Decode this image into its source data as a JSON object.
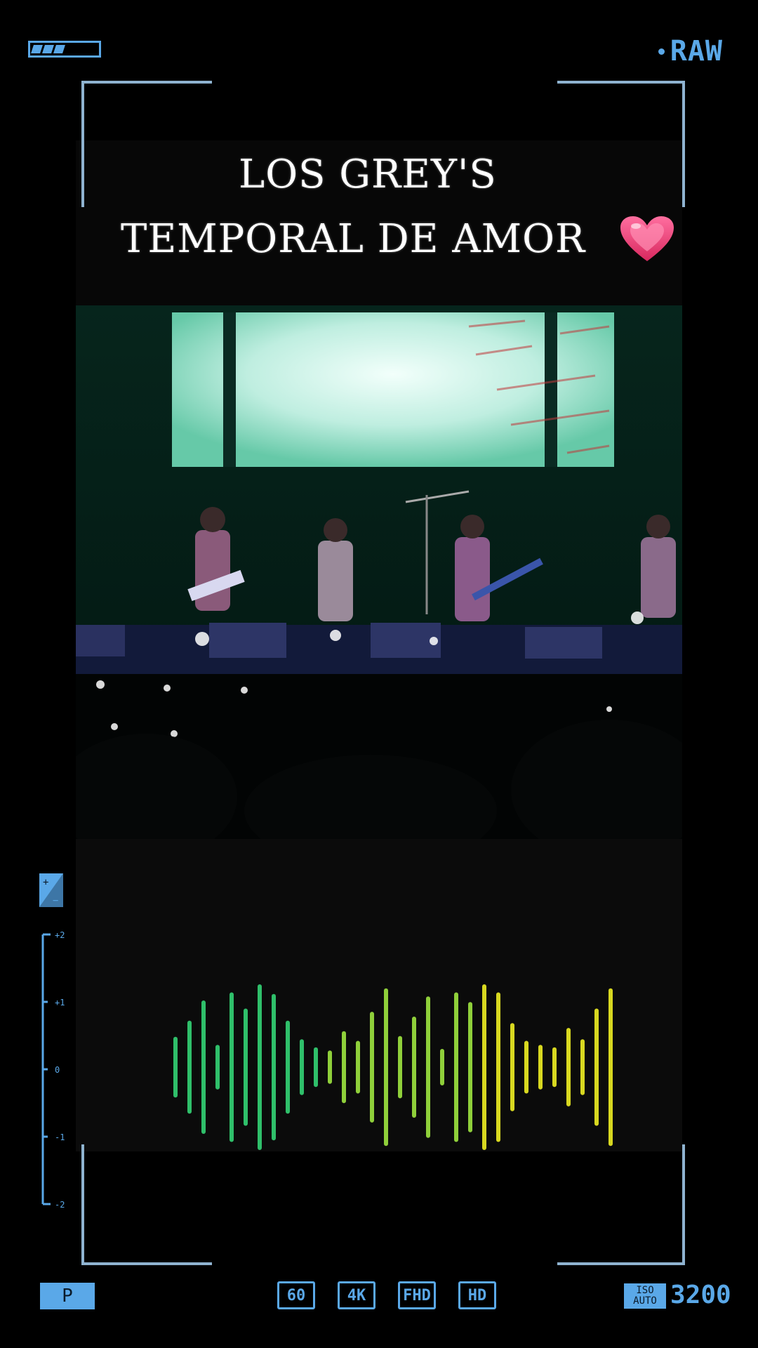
{
  "hud": {
    "raw_label": "RAW",
    "battery_icon": "battery-icon",
    "mode": "P",
    "badges": [
      "60",
      "4K",
      "FHD",
      "HD"
    ],
    "iso_label_top": "ISO",
    "iso_label_bottom": "AUTO",
    "iso_value": "3200",
    "exposure_icon": "exposure-compensation-icon",
    "exposure_scale": [
      "+2",
      "+1",
      "0",
      "-1",
      "-2"
    ],
    "accent_color": "#5aa8e8"
  },
  "title": {
    "line1": "LOS GREY'S",
    "line2": "TEMPORAL DE AMOR",
    "emoji": "growing-heart-emoji"
  },
  "video": {
    "description_icon": "concert-video-frame"
  },
  "waveform": {
    "bar_levels": [
      0.35,
      0.55,
      0.8,
      0.25,
      0.9,
      0.7,
      1.0,
      0.88,
      0.55,
      0.32,
      0.22,
      0.18,
      0.42,
      0.3,
      0.66,
      0.95,
      0.36,
      0.6,
      0.85,
      0.2,
      0.9,
      0.78,
      1.0,
      0.9,
      0.52,
      0.3,
      0.25,
      0.22,
      0.46,
      0.32,
      0.7,
      0.95
    ],
    "colors": [
      "#2fbf6a",
      "#8fcf3a",
      "#d8d820"
    ]
  }
}
